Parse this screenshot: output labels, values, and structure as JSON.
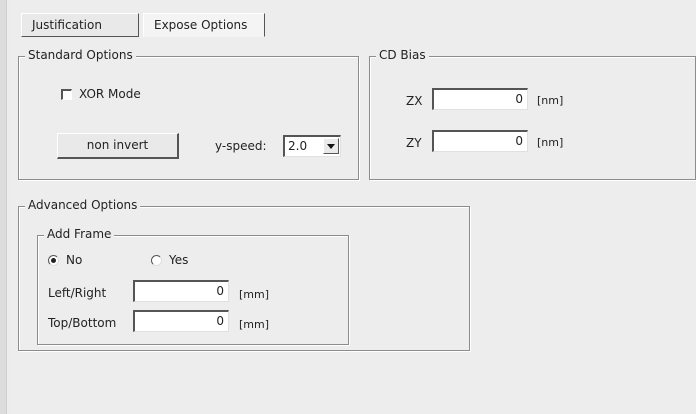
{
  "tabs": [
    {
      "label": "Justification",
      "active": false
    },
    {
      "label": "Expose Options",
      "active": true
    }
  ],
  "standard_options": {
    "title": "Standard Options",
    "xor_mode": {
      "label": "XOR Mode",
      "checked": false
    },
    "invert_button": {
      "label": "non invert"
    },
    "y_speed": {
      "label": "y-speed:",
      "value": "2.0"
    }
  },
  "cd_bias": {
    "title": "CD Bias",
    "zx": {
      "label": "ZX",
      "value": "0",
      "unit": "[nm]"
    },
    "zy": {
      "label": "ZY",
      "value": "0",
      "unit": "[nm]"
    }
  },
  "advanced_options": {
    "title": "Advanced Options",
    "add_frame": {
      "title": "Add Frame",
      "no_label": "No",
      "yes_label": "Yes",
      "selected": "No",
      "left_right": {
        "label": "Left/Right",
        "value": "0",
        "unit": "[mm]"
      },
      "top_bottom": {
        "label": "Top/Bottom",
        "value": "0",
        "unit": "[mm]"
      }
    }
  }
}
